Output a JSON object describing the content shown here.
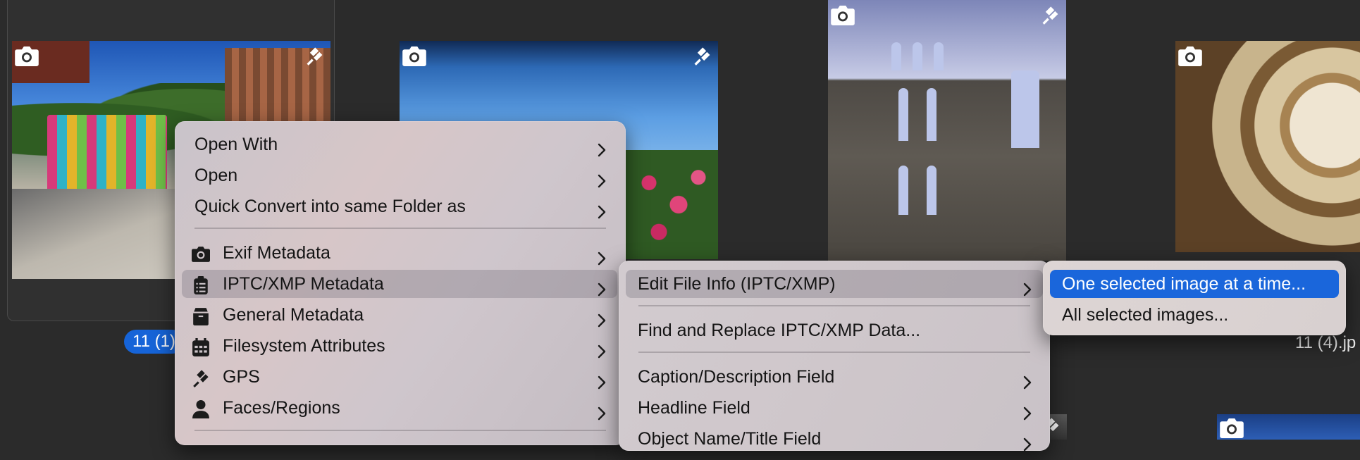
{
  "thumbnails": {
    "selected_filename": "11 (1)",
    "other_filename": "11 (4).jp"
  },
  "menu_main": {
    "items": [
      {
        "label": "Open With"
      },
      {
        "label": "Open"
      },
      {
        "label": "Quick Convert into same Folder as"
      },
      {
        "label": "Exif Metadata",
        "icon": "camera-icon"
      },
      {
        "label": "IPTC/XMP Metadata",
        "icon": "clipboard-icon"
      },
      {
        "label": "General Metadata",
        "icon": "box-icon"
      },
      {
        "label": "Filesystem Attributes",
        "icon": "calendar-icon"
      },
      {
        "label": "GPS",
        "icon": "satellite-icon"
      },
      {
        "label": "Faces/Regions",
        "icon": "person-icon"
      }
    ]
  },
  "menu_iptc": {
    "items": [
      {
        "label": "Edit File Info (IPTC/XMP)"
      },
      {
        "label": "Find and Replace IPTC/XMP Data..."
      },
      {
        "label": "Caption/Description Field"
      },
      {
        "label": "Headline Field"
      },
      {
        "label": "Object Name/Title Field"
      }
    ]
  },
  "menu_edit": {
    "items": [
      {
        "label": "One selected image at a time..."
      },
      {
        "label": "All selected images..."
      }
    ]
  },
  "colors": {
    "accent": "#1a66db",
    "background": "#2b2b2b"
  }
}
